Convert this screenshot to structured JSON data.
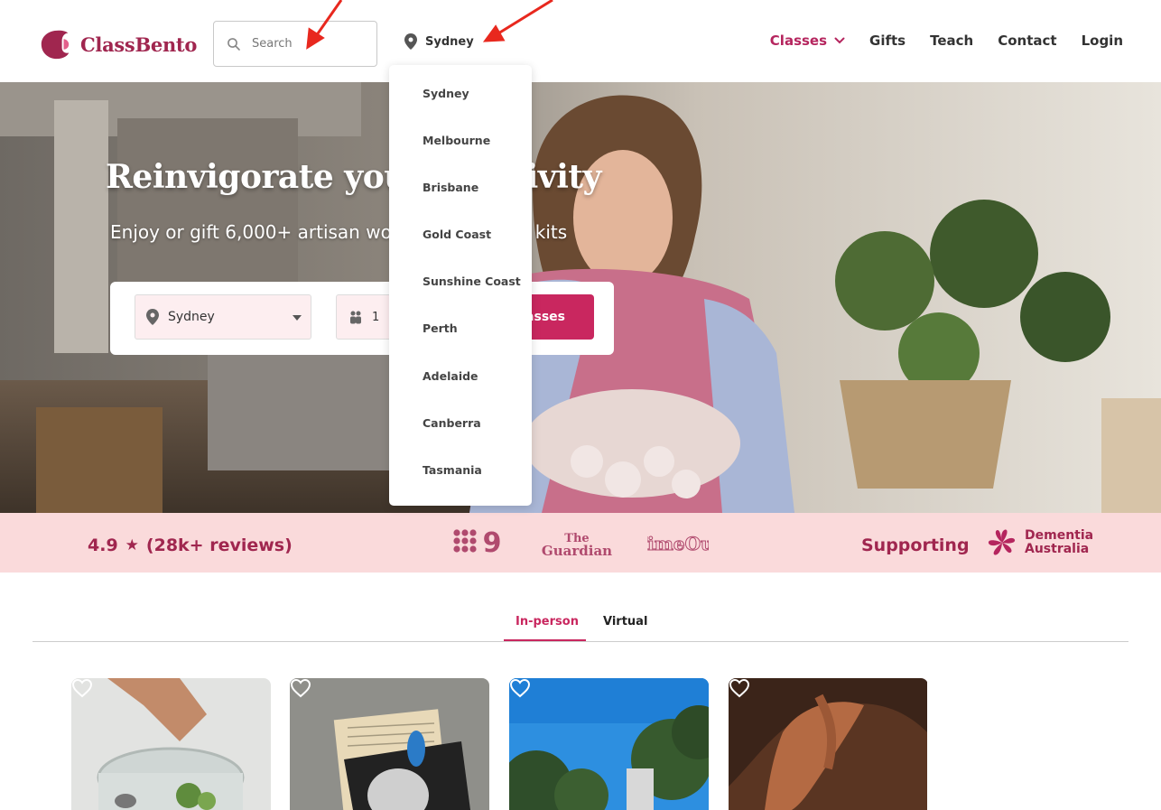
{
  "header": {
    "logo_text": "ClassBento",
    "search_placeholder": "Search",
    "location": "Sydney",
    "nav": {
      "classes": "Classes",
      "gifts": "Gifts",
      "teach": "Teach",
      "contact": "Contact",
      "login": "Login"
    }
  },
  "location_dropdown": {
    "options": [
      "Sydney",
      "Melbourne",
      "Brisbane",
      "Gold Coast",
      "Sunshine Coast",
      "Perth",
      "Adelaide",
      "Canberra",
      "Tasmania"
    ]
  },
  "hero": {
    "title": "Reinvigorate your creativity",
    "subtitle": "Enjoy or gift 6,000+ artisan workshops & craft kits",
    "location_select": "Sydney",
    "people_select": "1",
    "find_button": "Find classes"
  },
  "trust": {
    "rating": "4.9",
    "reviews": "(28k+ reviews)",
    "press_logos": [
      "9",
      "The Guardian",
      "TimeOut"
    ],
    "supporting_label": "Supporting",
    "charity": "Dementia Australia"
  },
  "tabs": [
    "In-person",
    "Virtual"
  ],
  "colors": {
    "brand": "#a0264f",
    "accent": "#c9275f",
    "strip": "#fadadb"
  },
  "icons": [
    "search-icon",
    "map-pin-icon",
    "chevron-down-icon",
    "people-icon",
    "star-icon",
    "heart-icon"
  ]
}
